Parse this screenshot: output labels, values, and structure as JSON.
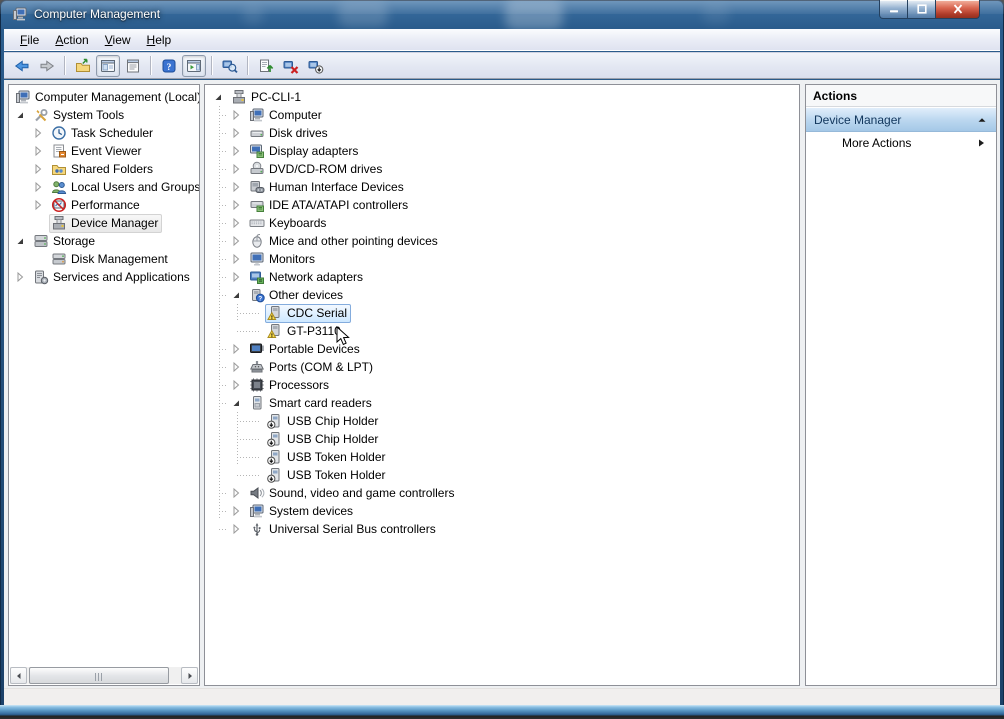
{
  "window": {
    "title": "Computer Management",
    "icon": "computer-management-icon",
    "controls": [
      {
        "name": "minimize-button",
        "icon": "minimize-icon"
      },
      {
        "name": "maximize-button",
        "icon": "maximize-icon"
      },
      {
        "name": "close-button",
        "icon": "close-icon"
      }
    ]
  },
  "menu": {
    "items": [
      {
        "label": "File"
      },
      {
        "label": "Action"
      },
      {
        "label": "View"
      },
      {
        "label": "Help"
      }
    ]
  },
  "toolbar": {
    "buttons": [
      {
        "icon": "back-icon"
      },
      {
        "icon": "forward-icon"
      },
      {
        "separator": true
      },
      {
        "icon": "up-one-level-icon"
      },
      {
        "icon": "show-console-tree-icon",
        "toggled": true
      },
      {
        "icon": "properties-icon"
      },
      {
        "separator": true
      },
      {
        "icon": "help-icon"
      },
      {
        "icon": "show-action-pane-icon",
        "toggled": true
      },
      {
        "separator": true
      },
      {
        "icon": "scan-hardware-changes-icon"
      },
      {
        "separator": true
      },
      {
        "icon": "update-driver-icon"
      },
      {
        "icon": "uninstall-device-icon"
      },
      {
        "icon": "disable-device-icon"
      }
    ]
  },
  "console_tree": {
    "items": [
      {
        "label": "Computer Management (Local)",
        "icon": "computer-management-icon",
        "depth": 0,
        "expander": "none"
      },
      {
        "label": "System Tools",
        "icon": "system-tools-icon",
        "depth": 1,
        "expander": "expanded"
      },
      {
        "label": "Task Scheduler",
        "icon": "task-scheduler-icon",
        "depth": 2,
        "expander": "collapsed"
      },
      {
        "label": "Event Viewer",
        "icon": "event-viewer-icon",
        "depth": 2,
        "expander": "collapsed"
      },
      {
        "label": "Shared Folders",
        "icon": "shared-folders-icon",
        "depth": 2,
        "expander": "collapsed"
      },
      {
        "label": "Local Users and Groups",
        "icon": "local-users-groups-icon",
        "depth": 2,
        "expander": "collapsed"
      },
      {
        "label": "Performance",
        "icon": "performance-icon",
        "depth": 2,
        "expander": "collapsed"
      },
      {
        "label": "Device Manager",
        "icon": "device-manager-icon",
        "depth": 2,
        "expander": "none",
        "selected": "inactive"
      },
      {
        "label": "Storage",
        "icon": "storage-icon",
        "depth": 1,
        "expander": "expanded"
      },
      {
        "label": "Disk Management",
        "icon": "disk-management-icon",
        "depth": 2,
        "expander": "none"
      },
      {
        "label": "Services and Applications",
        "icon": "services-applications-icon",
        "depth": 1,
        "expander": "collapsed"
      }
    ]
  },
  "device_tree": {
    "items": [
      {
        "label": "PC-CLI-1",
        "icon": "device-manager-icon",
        "depth": 0,
        "expander": "expanded"
      },
      {
        "label": "Computer",
        "icon": "computer-icon",
        "depth": 1,
        "expander": "collapsed"
      },
      {
        "label": "Disk drives",
        "icon": "disk-drive-icon",
        "depth": 1,
        "expander": "collapsed"
      },
      {
        "label": "Display adapters",
        "icon": "display-adapter-icon",
        "depth": 1,
        "expander": "collapsed"
      },
      {
        "label": "DVD/CD-ROM drives",
        "icon": "dvd-drive-icon",
        "depth": 1,
        "expander": "collapsed"
      },
      {
        "label": "Human Interface Devices",
        "icon": "hid-icon",
        "depth": 1,
        "expander": "collapsed"
      },
      {
        "label": "IDE ATA/ATAPI controllers",
        "icon": "ide-controller-icon",
        "depth": 1,
        "expander": "collapsed"
      },
      {
        "label": "Keyboards",
        "icon": "keyboard-icon",
        "depth": 1,
        "expander": "collapsed"
      },
      {
        "label": "Mice and other pointing devices",
        "icon": "mouse-icon",
        "depth": 1,
        "expander": "collapsed"
      },
      {
        "label": "Monitors",
        "icon": "monitor-icon",
        "depth": 1,
        "expander": "collapsed"
      },
      {
        "label": "Network adapters",
        "icon": "network-adapter-icon",
        "depth": 1,
        "expander": "collapsed"
      },
      {
        "label": "Other devices",
        "icon": "unknown-device-icon",
        "depth": 1,
        "expander": "expanded"
      },
      {
        "label": "CDC Serial",
        "icon": "warning-device-icon",
        "depth": 2,
        "expander": "none",
        "selected": "active"
      },
      {
        "label": "GT-P3110",
        "icon": "warning-device-icon",
        "depth": 2,
        "expander": "none"
      },
      {
        "label": "Portable Devices",
        "icon": "portable-device-icon",
        "depth": 1,
        "expander": "collapsed"
      },
      {
        "label": "Ports (COM & LPT)",
        "icon": "ports-icon",
        "depth": 1,
        "expander": "collapsed"
      },
      {
        "label": "Processors",
        "icon": "processor-icon",
        "depth": 1,
        "expander": "collapsed"
      },
      {
        "label": "Smart card readers",
        "icon": "smart-card-reader-icon",
        "depth": 1,
        "expander": "expanded"
      },
      {
        "label": "USB Chip Holder",
        "icon": "disabled-device-icon",
        "depth": 2,
        "expander": "none"
      },
      {
        "label": "USB Chip Holder",
        "icon": "disabled-device-icon",
        "depth": 2,
        "expander": "none"
      },
      {
        "label": "USB Token Holder",
        "icon": "disabled-device-icon",
        "depth": 2,
        "expander": "none"
      },
      {
        "label": "USB Token Holder",
        "icon": "disabled-device-icon",
        "depth": 2,
        "expander": "none"
      },
      {
        "label": "Sound, video and game controllers",
        "icon": "sound-icon",
        "depth": 1,
        "expander": "collapsed"
      },
      {
        "label": "System devices",
        "icon": "computer-icon",
        "depth": 1,
        "expander": "collapsed"
      },
      {
        "label": "Universal Serial Bus controllers",
        "icon": "usb-icon",
        "depth": 1,
        "expander": "collapsed"
      }
    ]
  },
  "actions_pane": {
    "title": "Actions",
    "group": {
      "label": "Device Manager",
      "icon": "collapse-chevron-icon"
    },
    "more": {
      "label": "More Actions",
      "icon": "submenu-arrow-icon"
    }
  },
  "colors": {
    "titlebar_top": "#3c71a4",
    "titlebar_bottom": "#1b4068",
    "selection_fill": "#cde8ff",
    "selection_border": "#84acdd",
    "inactive_selection_fill": "#e8e8e8",
    "actions_group_fill": "#bdd8f0",
    "warning_yellow": "#fadd4b",
    "close_button_red": "#d8644e",
    "chrome_fill": "#e3e7f2",
    "status_bar_fill": "#f1efee"
  }
}
